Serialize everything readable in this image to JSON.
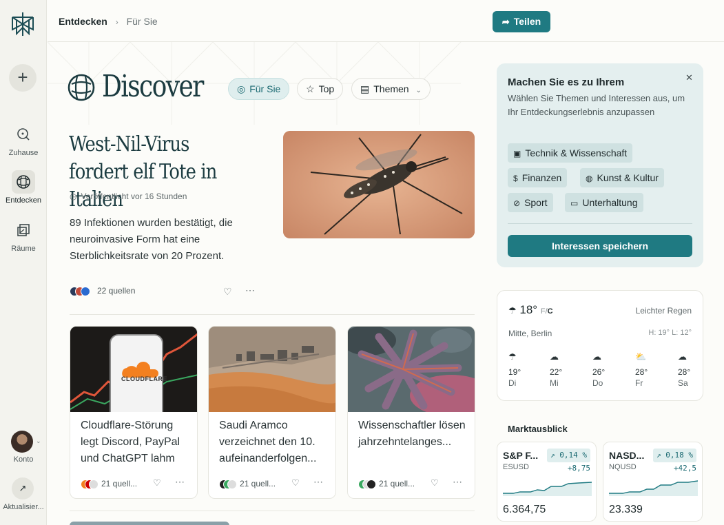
{
  "rail": {
    "nav": [
      {
        "label": "Zuhause",
        "icon": "home-search-icon"
      },
      {
        "label": "Entdecken",
        "icon": "discover-globe-icon"
      },
      {
        "label": "Räume",
        "icon": "spaces-icon"
      }
    ],
    "account_label": "Konto",
    "update_label": "Aktualisier..."
  },
  "topbar": {
    "breadcrumb": [
      "Entdecken",
      "Für Sie"
    ],
    "share_label": "Teilen"
  },
  "header": {
    "title": "Discover",
    "tabs": [
      {
        "label": "Für Sie",
        "active": true
      },
      {
        "label": "Top",
        "active": false
      },
      {
        "label": "Themen",
        "active": false
      }
    ]
  },
  "hero": {
    "title": "West-Nil-Virus fordert elf Tote in Italien",
    "time": "Veröffentlicht vor 16 Stunden",
    "description": "89 Infektionen wurden bestätigt, die neuroinvasive Form hat eine Sterblichkeitsrate von 20 Prozent.",
    "sources": "22 quellen"
  },
  "cards": [
    {
      "title": "Cloudflare-Störung legt Discord, PayPal und ChatGPT lahm",
      "sources": "21 quell...",
      "img_text": "CLOUDFLARE"
    },
    {
      "title": "Saudi Aramco verzeichnet den 10. aufeinanderfolgen...",
      "sources": "21 quell..."
    },
    {
      "title": "Wissenschaftler lösen jahrzehntelanges...",
      "sources": "21 quell..."
    }
  ],
  "interests": {
    "title": "Machen Sie es zu Ihrem",
    "subtitle": "Wählen Sie Themen und Interessen aus, um Ihr Entdeckungserlebnis anzupassen",
    "tags": [
      "Technik & Wissenschaft",
      "Finanzen",
      "Kunst & Kultur",
      "Sport",
      "Unterhaltung"
    ],
    "save_label": "Interessen speichern"
  },
  "weather": {
    "temp": "18°",
    "unit_f": "F",
    "unit_c": "C",
    "condition": "Leichter Regen",
    "location": "Mitte, Berlin",
    "high_low": "H: 19° L: 12°",
    "forecast": [
      {
        "temp": "19°",
        "day": "Di"
      },
      {
        "temp": "22°",
        "day": "Mi"
      },
      {
        "temp": "26°",
        "day": "Do"
      },
      {
        "temp": "28°",
        "day": "Fr"
      },
      {
        "temp": "28°",
        "day": "Sa"
      }
    ]
  },
  "market": {
    "title": "Marktausblick",
    "items": [
      {
        "name": "S&P F...",
        "change_pct": "↗ 0,14 %",
        "symbol": "ESUSD",
        "change_abs": "+8,75",
        "value": "6.364,75"
      },
      {
        "name": "NASD...",
        "change_pct": "↗ 0,18 %",
        "symbol": "NQUSD",
        "change_abs": "+42,5",
        "value": "23.339"
      }
    ]
  },
  "colors": {
    "accent": "#1f7a82",
    "panel": "#e4efef"
  }
}
